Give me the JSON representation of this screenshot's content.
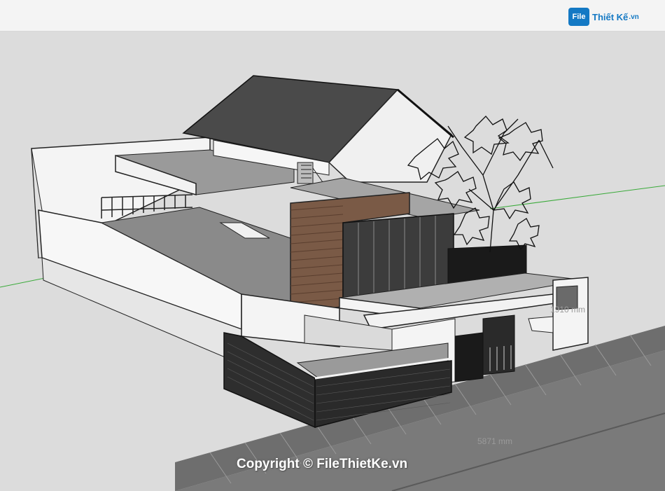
{
  "brand": {
    "badge": "File",
    "name": "Thiết Kế",
    "suffix": ".vn"
  },
  "dimensions": {
    "height_label": "1910 mm",
    "width_label": "5871 mm"
  },
  "copyright": "Copyright © FileThietKe.vn",
  "scene": {
    "subject": "3d-house-model",
    "icon": "tree-icon"
  },
  "colors": {
    "background": "#dcdcdc",
    "roof": "#4a4a4a",
    "wood": "#7a5a46",
    "axis_green": "#3aaa3a"
  }
}
